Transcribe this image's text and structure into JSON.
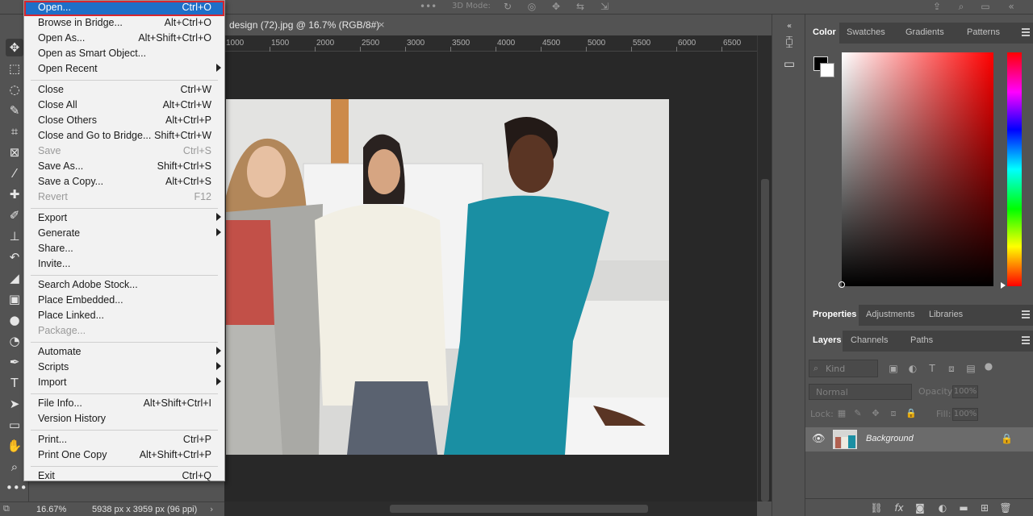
{
  "document": {
    "tab_label": "design (72).jpg @ 16.7% (RGB/8#)",
    "close_glyph": "×",
    "ruler_labels": [
      "1000",
      "1500",
      "2000",
      "2500",
      "3000",
      "3500",
      "4000",
      "4500",
      "5000",
      "5500",
      "6000",
      "6500"
    ]
  },
  "status": {
    "zoom": "16.67%",
    "dimensions": "5938 px x 3959 px (96 ppi)",
    "arrow": "›"
  },
  "options_bar": {
    "mode_label": "3D Mode:"
  },
  "file_menu": {
    "groups": [
      [
        {
          "label": "Open...",
          "shortcut": "Ctrl+O",
          "highlight": true
        },
        {
          "label": "Browse in Bridge...",
          "shortcut": "Alt+Ctrl+O"
        },
        {
          "label": "Open As...",
          "shortcut": "Alt+Shift+Ctrl+O"
        },
        {
          "label": "Open as Smart Object...",
          "shortcut": ""
        },
        {
          "label": "Open Recent",
          "shortcut": "",
          "submenu": true
        }
      ],
      [
        {
          "label": "Close",
          "shortcut": "Ctrl+W"
        },
        {
          "label": "Close All",
          "shortcut": "Alt+Ctrl+W"
        },
        {
          "label": "Close Others",
          "shortcut": "Alt+Ctrl+P"
        },
        {
          "label": "Close and Go to Bridge...",
          "shortcut": "Shift+Ctrl+W"
        },
        {
          "label": "Save",
          "shortcut": "Ctrl+S",
          "disabled": true
        },
        {
          "label": "Save As...",
          "shortcut": "Shift+Ctrl+S"
        },
        {
          "label": "Save a Copy...",
          "shortcut": "Alt+Ctrl+S"
        },
        {
          "label": "Revert",
          "shortcut": "F12",
          "disabled": true
        }
      ],
      [
        {
          "label": "Export",
          "shortcut": "",
          "submenu": true
        },
        {
          "label": "Generate",
          "shortcut": "",
          "submenu": true
        },
        {
          "label": "Share...",
          "shortcut": ""
        },
        {
          "label": "Invite...",
          "shortcut": ""
        }
      ],
      [
        {
          "label": "Search Adobe Stock...",
          "shortcut": ""
        },
        {
          "label": "Place Embedded...",
          "shortcut": ""
        },
        {
          "label": "Place Linked...",
          "shortcut": ""
        },
        {
          "label": "Package...",
          "shortcut": "",
          "disabled": true
        }
      ],
      [
        {
          "label": "Automate",
          "shortcut": "",
          "submenu": true
        },
        {
          "label": "Scripts",
          "shortcut": "",
          "submenu": true
        },
        {
          "label": "Import",
          "shortcut": "",
          "submenu": true
        }
      ],
      [
        {
          "label": "File Info...",
          "shortcut": "Alt+Shift+Ctrl+I"
        },
        {
          "label": "Version History",
          "shortcut": ""
        }
      ],
      [
        {
          "label": "Print...",
          "shortcut": "Ctrl+P"
        },
        {
          "label": "Print One Copy",
          "shortcut": "Alt+Shift+Ctrl+P"
        }
      ],
      [
        {
          "label": "Exit",
          "shortcut": "Ctrl+Q"
        }
      ]
    ]
  },
  "color_panel": {
    "tabs": [
      "Color",
      "Swatches",
      "Gradients",
      "Patterns"
    ],
    "active_tab": "Color",
    "foreground": "#000000",
    "background": "#ffffff",
    "hue": "#ff0000"
  },
  "properties_panel": {
    "tabs": [
      "Properties",
      "Adjustments",
      "Libraries"
    ],
    "active_tab": "Properties"
  },
  "layers_panel": {
    "tabs": [
      "Layers",
      "Channels",
      "Paths"
    ],
    "active_tab": "Layers",
    "filter_placeholder": "Kind",
    "blend_mode": "Normal",
    "opacity_label": "Opacity:",
    "opacity_value": "100%",
    "lock_label": "Lock:",
    "fill_label": "Fill:",
    "fill_value": "100%",
    "layers": [
      {
        "name": "Background",
        "visible": true,
        "locked": true
      }
    ]
  },
  "tools": [
    "move-icon",
    "marquee-icon",
    "lasso-icon",
    "quick-select-icon",
    "crop-icon",
    "frame-icon",
    "eyedropper-icon",
    "healing-icon",
    "brush-icon",
    "stamp-icon",
    "history-brush-icon",
    "eraser-icon",
    "gradient-icon",
    "blur-icon",
    "dodge-icon",
    "pen-icon",
    "type-icon",
    "path-select-icon",
    "rectangle-icon",
    "hand-icon",
    "zoom-icon",
    "more-tools-icon"
  ]
}
